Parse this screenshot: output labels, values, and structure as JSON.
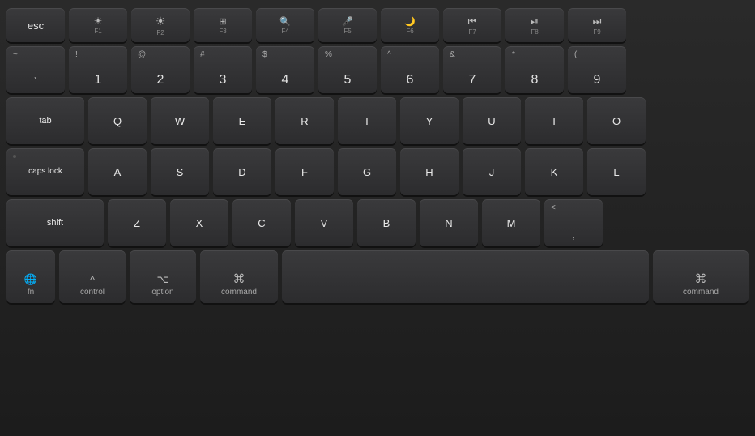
{
  "keyboard": {
    "background_color": "#1c1c1e",
    "rows": {
      "fn_row": {
        "keys": [
          {
            "id": "esc",
            "main": "esc",
            "label_type": "text"
          },
          {
            "id": "f1",
            "fn": "F1",
            "icon": "☀",
            "icon_type": "brightness-low"
          },
          {
            "id": "f2",
            "fn": "F2",
            "icon": "☀",
            "icon_type": "brightness-high"
          },
          {
            "id": "f3",
            "fn": "F3",
            "icon": "⊞",
            "icon_type": "mission-control"
          },
          {
            "id": "f4",
            "fn": "F4",
            "icon": "⌕",
            "icon_type": "search"
          },
          {
            "id": "f5",
            "fn": "F5",
            "icon": "⍤",
            "icon_type": "dictation"
          },
          {
            "id": "f6",
            "fn": "F6",
            "icon": "☽",
            "icon_type": "do-not-disturb"
          },
          {
            "id": "f7",
            "fn": "F7",
            "icon": "⏮",
            "icon_type": "rewind"
          },
          {
            "id": "f8",
            "fn": "F8",
            "icon": "⏯",
            "icon_type": "play-pause"
          },
          {
            "id": "f9",
            "fn": "F9",
            "icon": "⏭",
            "icon_type": "fast-forward"
          }
        ]
      },
      "num_row": {
        "keys": [
          {
            "id": "tilde",
            "top": "~",
            "bottom": "`"
          },
          {
            "id": "1",
            "top": "!",
            "bottom": "1"
          },
          {
            "id": "2",
            "top": "@",
            "bottom": "2"
          },
          {
            "id": "3",
            "top": "#",
            "bottom": "3"
          },
          {
            "id": "4",
            "top": "$",
            "bottom": "4"
          },
          {
            "id": "5",
            "top": "%",
            "bottom": "5"
          },
          {
            "id": "6",
            "top": "^",
            "bottom": "6"
          },
          {
            "id": "7",
            "top": "&",
            "bottom": "7"
          },
          {
            "id": "8",
            "top": "*",
            "bottom": "8"
          },
          {
            "id": "9",
            "top": "(",
            "bottom": "9"
          }
        ]
      },
      "qwerty_row": {
        "tab_label": "tab",
        "keys": [
          "Q",
          "W",
          "E",
          "R",
          "T",
          "Y",
          "U",
          "I",
          "O"
        ]
      },
      "asdf_row": {
        "caps_label": "caps lock",
        "keys": [
          "A",
          "S",
          "D",
          "F",
          "G",
          "H",
          "J",
          "K",
          "L"
        ]
      },
      "zxcv_row": {
        "shift_label": "shift",
        "keys": [
          "Z",
          "X",
          "C",
          "V",
          "B",
          "N",
          "M"
        ],
        "end_key": {
          "top": "<",
          "bottom": ","
        }
      },
      "bottom_row": {
        "fn_label": "fn",
        "globe_icon": "⊕",
        "control_top": "^",
        "control_label": "control",
        "option_top": "⌥",
        "option_label": "option",
        "command_left_top": "⌘",
        "command_left_label": "command",
        "command_right_top": "⌘",
        "command_right_label": "command"
      }
    }
  }
}
